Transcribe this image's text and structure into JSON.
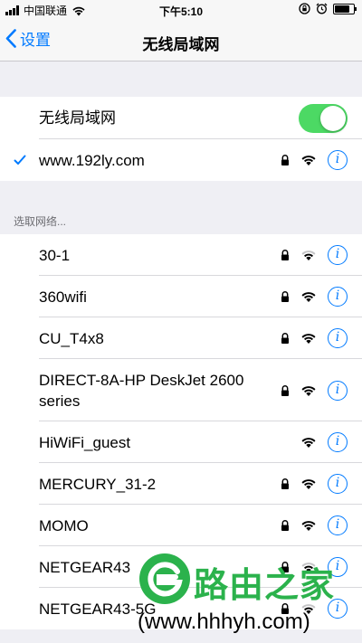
{
  "status_bar": {
    "carrier": "中国联通",
    "time": "下午5:10",
    "battery_level": 0.9
  },
  "nav": {
    "back_label": "设置",
    "title": "无线局域网"
  },
  "wifi_toggle": {
    "label": "无线局域网",
    "on": true
  },
  "connected": {
    "name": "www.192ly.com",
    "locked": true
  },
  "section_header": "选取网络...",
  "networks": [
    {
      "name": "30-1",
      "locked": true,
      "signal": 2
    },
    {
      "name": "360wifi",
      "locked": true,
      "signal": 3
    },
    {
      "name": "CU_T4x8",
      "locked": true,
      "signal": 3
    },
    {
      "name": "DIRECT-8A-HP DeskJet 2600 series",
      "locked": true,
      "signal": 3
    },
    {
      "name": "HiWiFi_guest",
      "locked": false,
      "signal": 3
    },
    {
      "name": "MERCURY_31-2",
      "locked": true,
      "signal": 3
    },
    {
      "name": "MOMO",
      "locked": true,
      "signal": 3
    },
    {
      "name": "NETGEAR43",
      "locked": true,
      "signal": 2
    },
    {
      "name": "NETGEAR43-5G",
      "locked": true,
      "signal": 2
    }
  ],
  "watermark": {
    "logo_text": "路由之家",
    "url": "(www.hhhyh.com)"
  },
  "colors": {
    "accent": "#007aff",
    "toggle_on": "#4cd964",
    "logo_green": "#2bb24c"
  }
}
